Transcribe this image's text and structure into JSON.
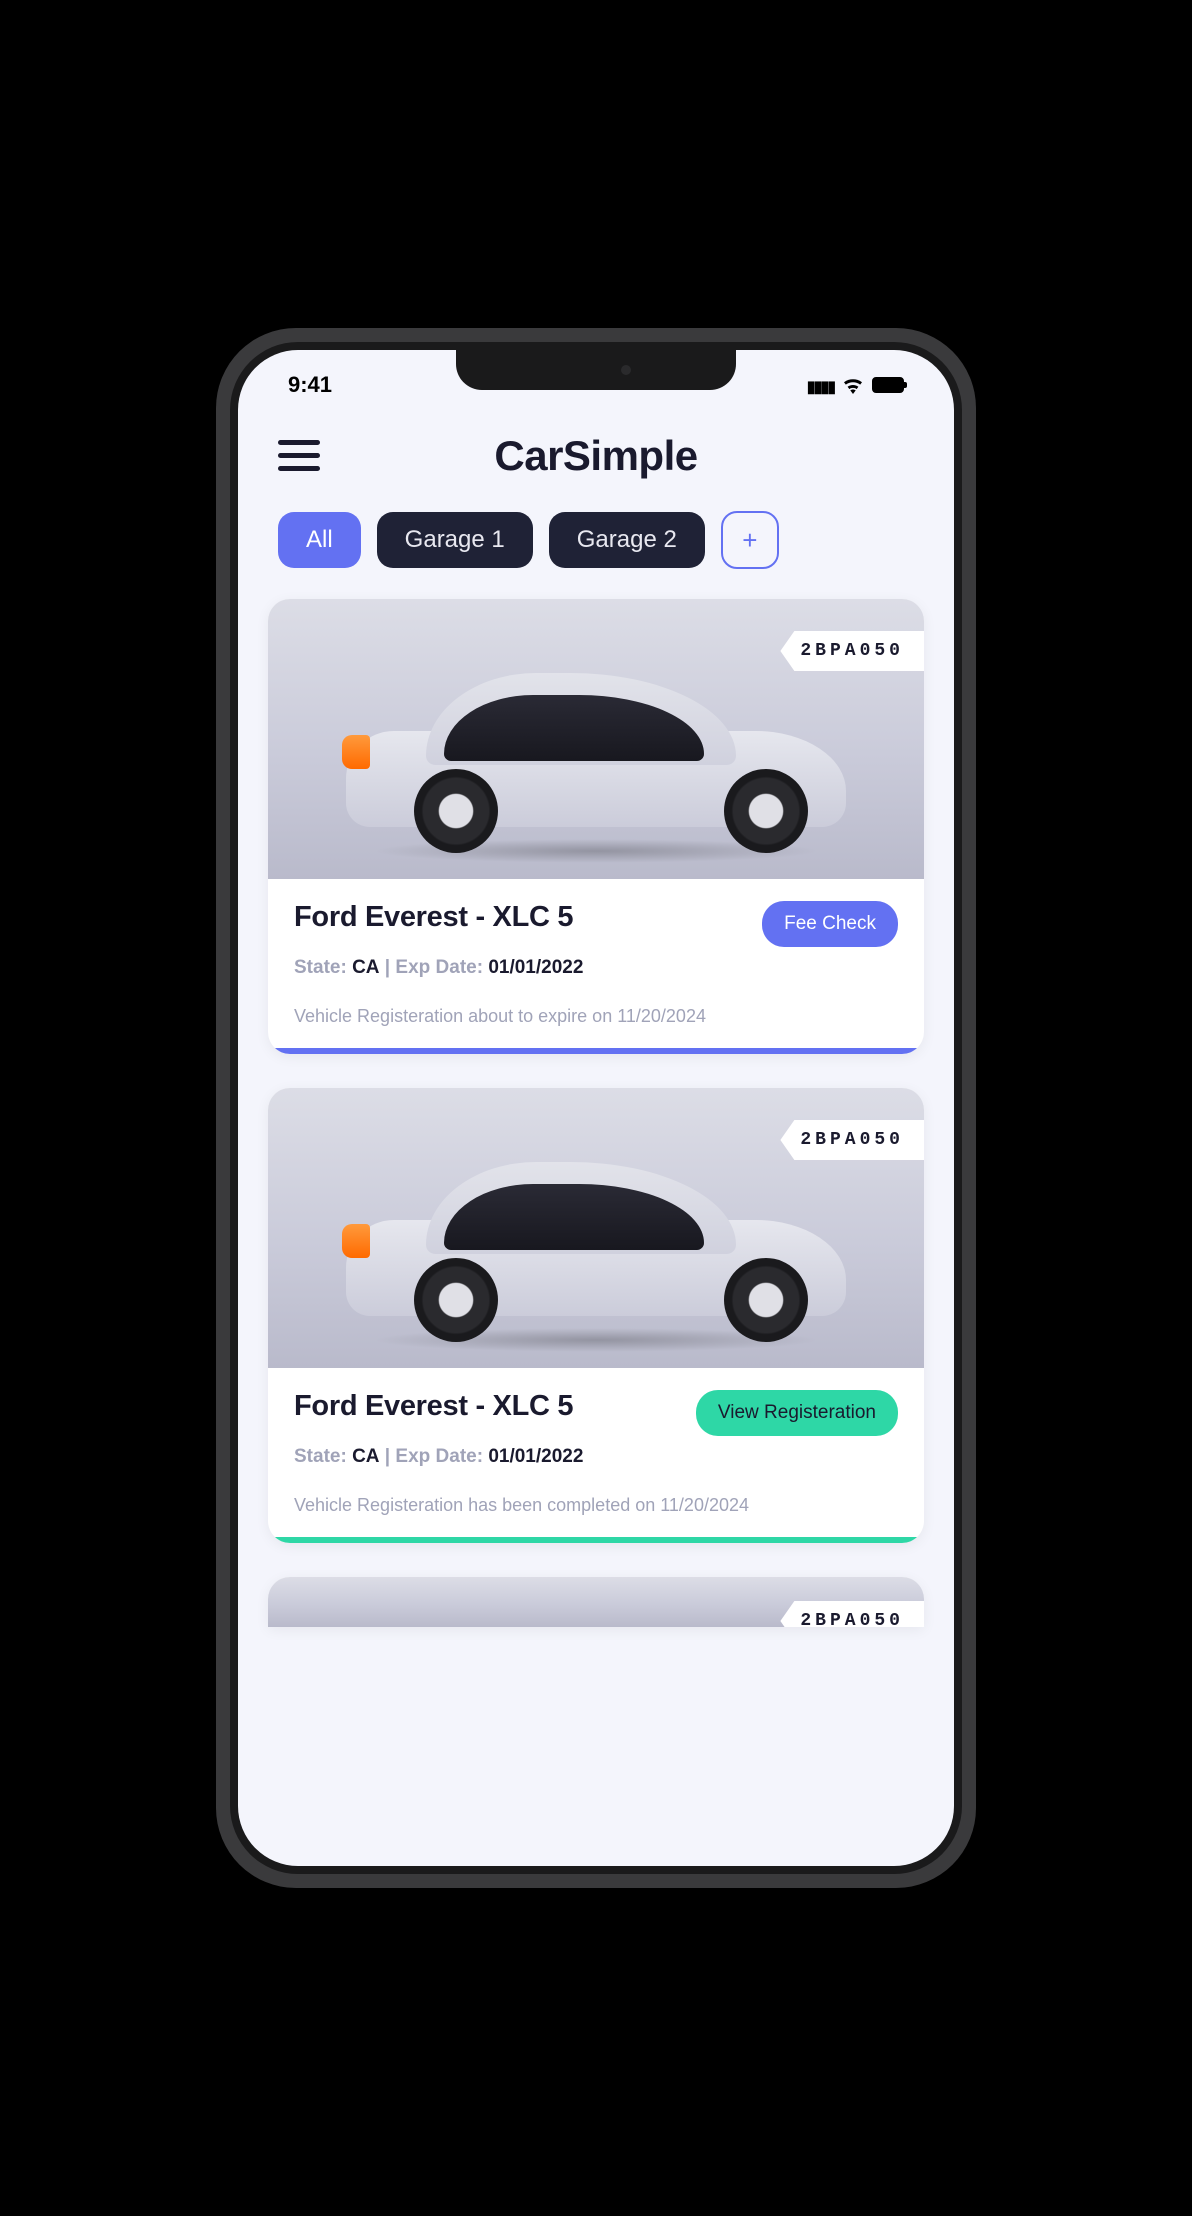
{
  "status": {
    "time": "9:41"
  },
  "header": {
    "title": "CarSimple"
  },
  "filters": {
    "all": "All",
    "items": [
      "Garage 1",
      "Garage 2"
    ],
    "add": "+"
  },
  "cards": [
    {
      "plate": "2BPA050",
      "title": "Ford Everest - XLC 5",
      "state_label": "State:",
      "state": "CA",
      "sep": " | ",
      "exp_label": "Exp Date:",
      "exp": "01/01/2022",
      "action": "Fee Check",
      "action_style": "blue",
      "note": "Vehicle  Registeration about to expire on 11/20/2024",
      "bar": "blue"
    },
    {
      "plate": "2BPA050",
      "title": "Ford Everest - XLC 5",
      "state_label": "State:",
      "state": "CA",
      "sep": " | ",
      "exp_label": "Exp Date:",
      "exp": "01/01/2022",
      "action": "View Registeration",
      "action_style": "teal",
      "note": "Vehicle  Registeration has been completed on 11/20/2024",
      "bar": "teal"
    }
  ],
  "peek": {
    "plate": "2BPA050"
  },
  "colors": {
    "blue": "#6371f2",
    "teal": "#2ed7a6",
    "dark": "#1f2236"
  }
}
